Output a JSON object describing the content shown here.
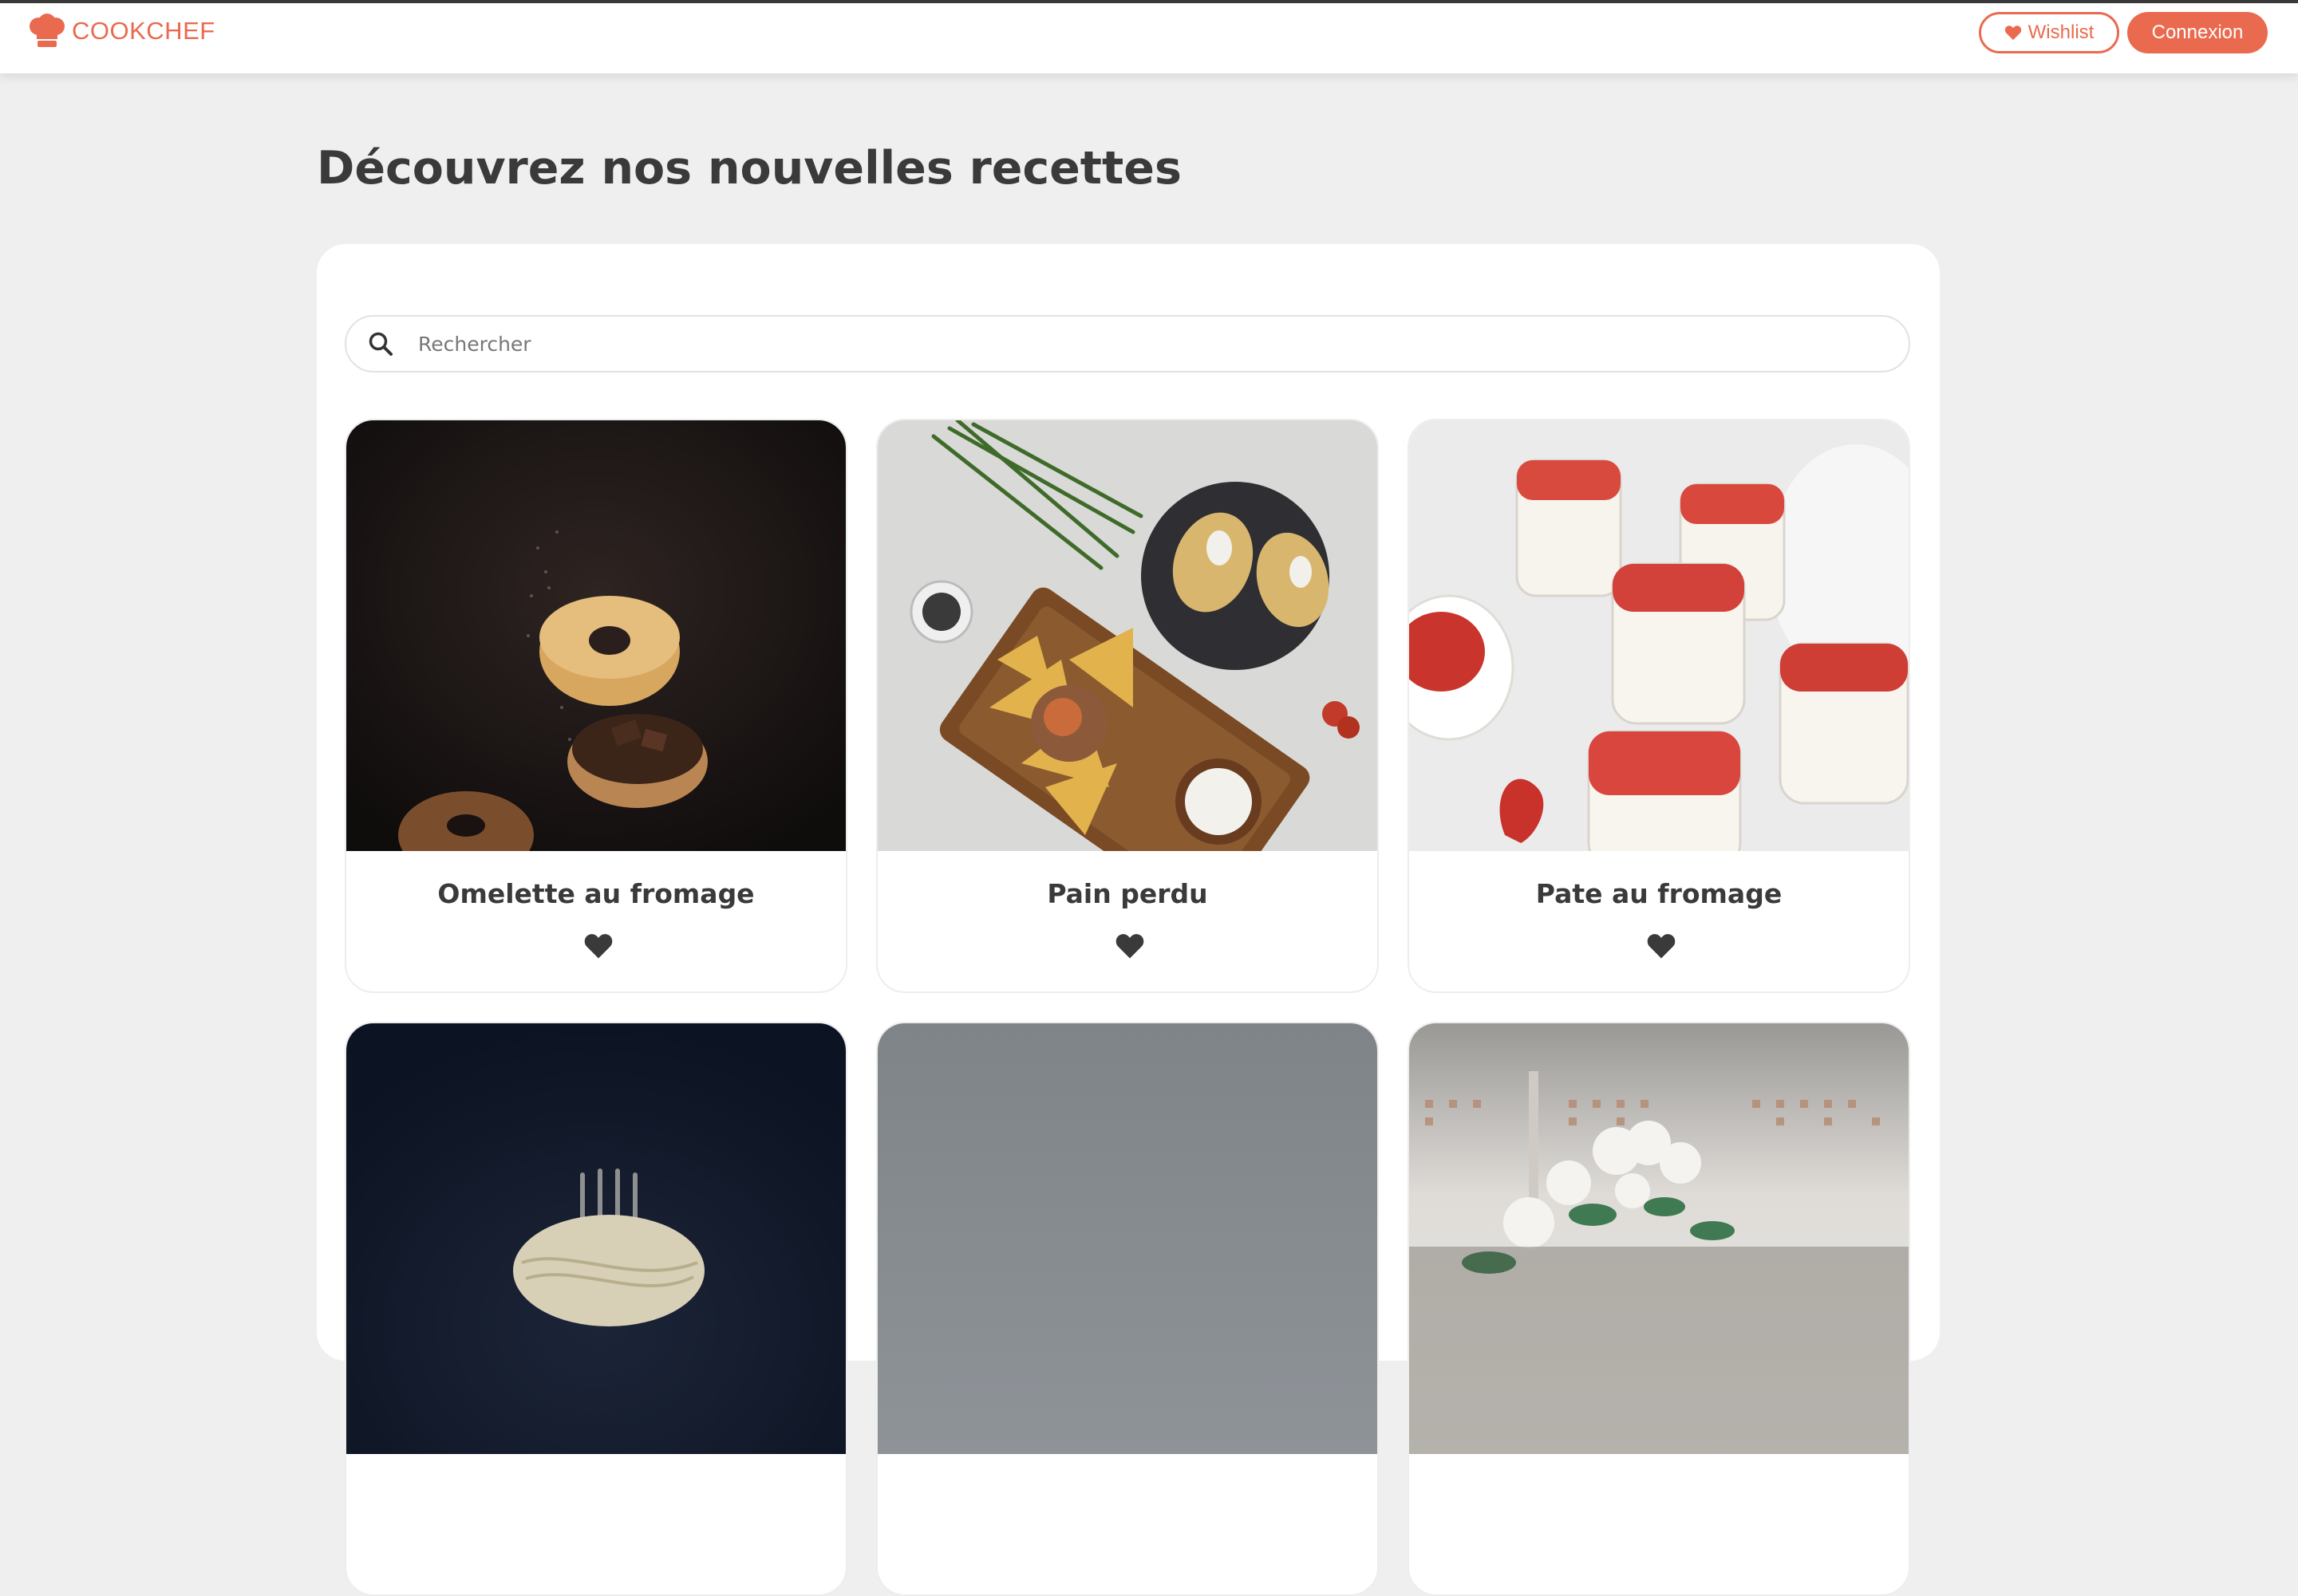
{
  "app": {
    "brand": "COOKCHEF",
    "brand_color": "#ea6a4f",
    "logo_icon": "chef-hat-icon"
  },
  "nav": {
    "wishlist_label": "Wishlist",
    "wishlist_icon": "heart-icon",
    "login_label": "Connexion"
  },
  "page": {
    "title": "Découvrez nos nouvelles recettes"
  },
  "search": {
    "placeholder": "Rechercher",
    "icon": "search-icon"
  },
  "recipes": [
    {
      "title": "Omelette au fromage",
      "image": "donuts-photo",
      "favorite_icon": "heart-icon"
    },
    {
      "title": "Pain perdu",
      "image": "nachos-board-photo",
      "favorite_icon": "heart-icon"
    },
    {
      "title": "Pate au fromage",
      "image": "panna-cotta-strawberries-photo",
      "favorite_icon": "heart-icon"
    },
    {
      "title": "",
      "image": "pasta-fork-photo",
      "favorite_icon": "heart-icon"
    },
    {
      "title": "",
      "image": "grey-backdrop-photo",
      "favorite_icon": "heart-icon"
    },
    {
      "title": "",
      "image": "flowers-cake-photo",
      "favorite_icon": "heart-icon"
    }
  ]
}
